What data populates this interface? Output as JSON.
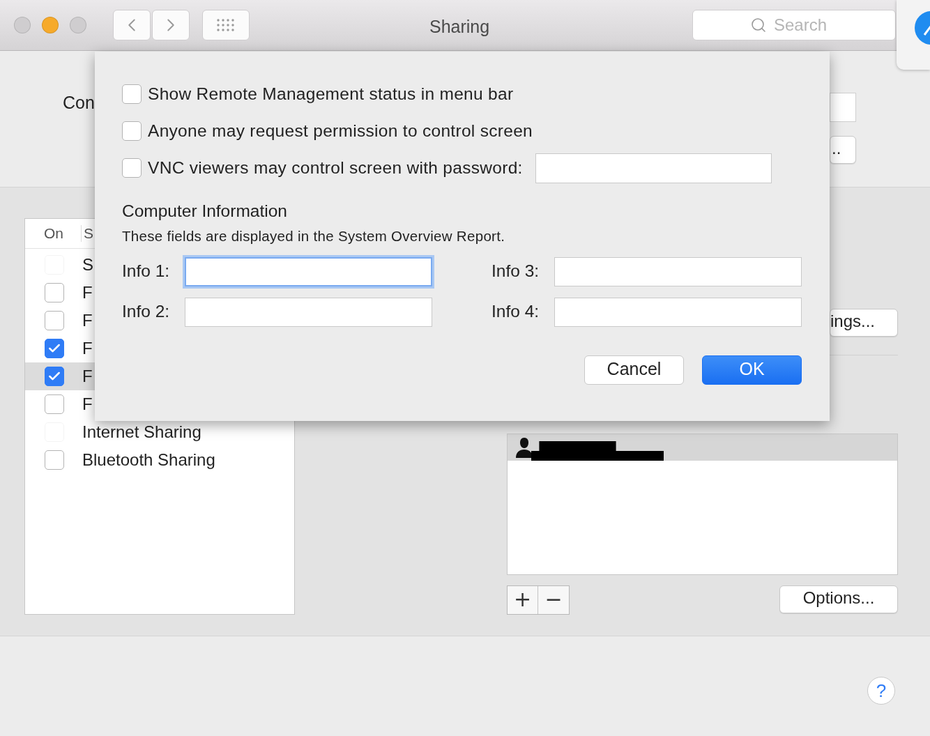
{
  "window": {
    "title": "Sharing",
    "search": {
      "placeholder": "Search"
    }
  },
  "computer_name": {
    "label": "Con",
    "edit_button": ".."
  },
  "services": {
    "columns": [
      "On",
      "S"
    ],
    "items": [
      {
        "name": "S",
        "on": false,
        "disabled": true,
        "selected": false
      },
      {
        "name": "F",
        "on": false,
        "disabled": false,
        "selected": false
      },
      {
        "name": "F",
        "on": false,
        "disabled": false,
        "selected": false
      },
      {
        "name": "F",
        "on": true,
        "disabled": false,
        "selected": false
      },
      {
        "name": "F",
        "on": true,
        "disabled": false,
        "selected": true
      },
      {
        "name": "F",
        "on": false,
        "disabled": false,
        "selected": false
      },
      {
        "name": "Internet Sharing",
        "on": false,
        "disabled": true,
        "selected": false
      },
      {
        "name": "Bluetooth Sharing",
        "on": false,
        "disabled": false,
        "selected": false
      }
    ]
  },
  "settings_button": "ings...",
  "users": [
    {
      "selected": true
    }
  ],
  "list_buttons": [
    "+",
    "−"
  ],
  "options_button": "Options...",
  "help_button": "?",
  "sheet": {
    "options": [
      {
        "label": "Show Remote Management status in menu bar",
        "checked": false,
        "kind": "plain"
      },
      {
        "label": "Anyone may request permission to control screen",
        "checked": false,
        "kind": "plain"
      },
      {
        "label": "VNC viewers may control screen with password:",
        "checked": false,
        "kind": "password"
      }
    ],
    "info_title": "Computer Information",
    "info_description": "These fields are displayed in the System Overview Report.",
    "info_fields": [
      {
        "label": "Info 1:",
        "focused": true
      },
      {
        "label": "Info 3:",
        "focused": false
      },
      {
        "label": "Info 2:",
        "focused": false
      },
      {
        "label": "Info 4:",
        "focused": false
      }
    ],
    "buttons": [
      {
        "label": "Cancel",
        "default": false
      },
      {
        "label": "OK",
        "default": true
      }
    ]
  }
}
